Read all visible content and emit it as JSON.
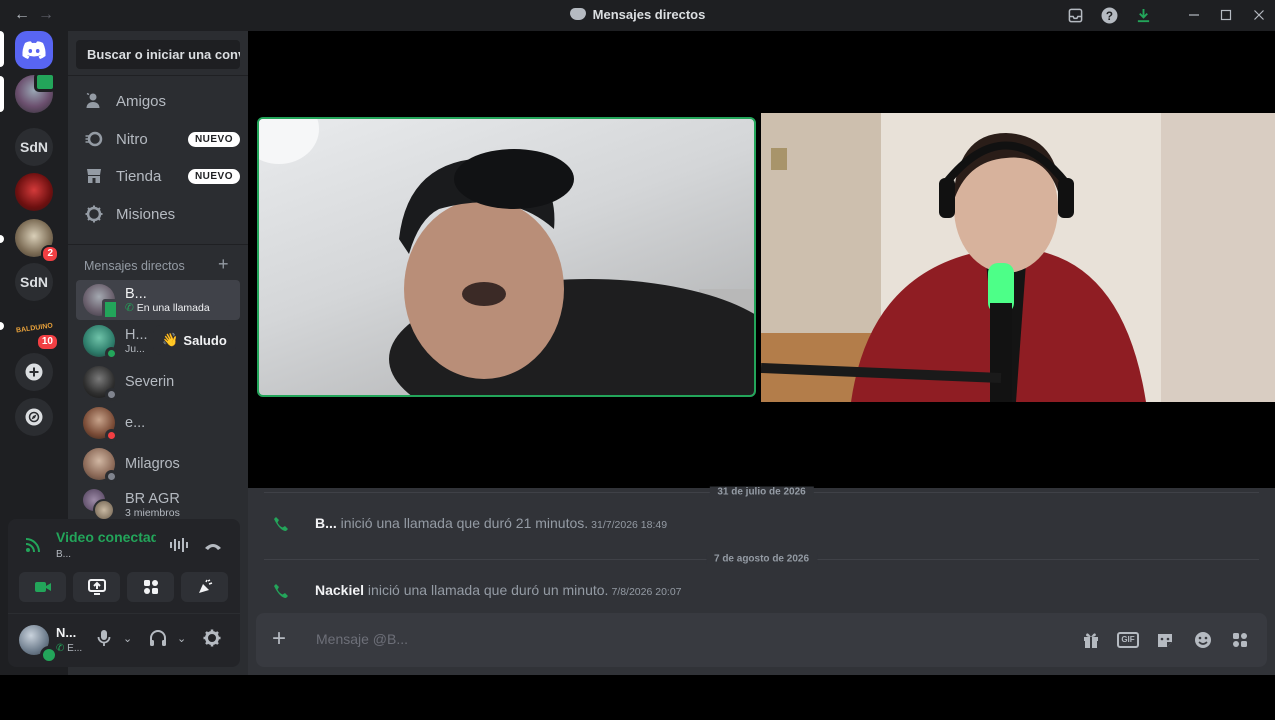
{
  "titlebar": {
    "back": "←",
    "forward": "→",
    "title": "Mensajes directos",
    "icons": [
      "inbox-icon",
      "help-icon",
      "download-icon",
      "minimize-icon",
      "maximize-icon",
      "close-icon"
    ]
  },
  "rail": {
    "servers": [
      {
        "type": "home",
        "icon": "discord-logo-icon"
      },
      {
        "type": "avatar",
        "status": "video-call"
      },
      {
        "type": "text",
        "label": "SdN"
      },
      {
        "type": "avatar"
      },
      {
        "type": "avatar",
        "badge": "2"
      },
      {
        "type": "text",
        "label": "SdN"
      },
      {
        "type": "avatar",
        "label": "BALDUINO",
        "badge": "10"
      },
      {
        "type": "add",
        "icon": "+"
      },
      {
        "type": "explore",
        "icon": "compass-icon"
      }
    ]
  },
  "sidebar": {
    "search": "Buscar o iniciar una conversación",
    "nav": [
      {
        "label": "Amigos",
        "icon": "friends-icon"
      },
      {
        "label": "Nitro",
        "icon": "nitro-icon",
        "badge": "NUEVO"
      },
      {
        "label": "Tienda",
        "icon": "shop-icon",
        "badge": "NUEVO"
      },
      {
        "label": "Misiones",
        "icon": "quests-icon"
      }
    ],
    "dm_header": "Mensajes directos",
    "dm_add": "+",
    "dms": [
      {
        "name": "B...",
        "sub": "En una llamada",
        "status": "mobile-green",
        "active": true
      },
      {
        "name": "H...",
        "sub": "Ju...",
        "status": "online"
      },
      {
        "name": "Severin",
        "sub": "",
        "status": "offline"
      },
      {
        "name": "e...",
        "sub": "",
        "status": "dnd"
      },
      {
        "name": "Milagros",
        "sub": "",
        "status": "offline"
      },
      {
        "name": "BR AGR",
        "sub": "3 miembros",
        "status": "group"
      }
    ],
    "wave_button": "Saludo",
    "colors": {
      "accent": "#5865f2",
      "green": "#23a55a",
      "red": "#f23f43"
    }
  },
  "voice": {
    "status": "Video conectado",
    "channel": "B...",
    "buttons": [
      "camera-icon",
      "screen-share-icon",
      "activities-icon",
      "soundboard-icon"
    ]
  },
  "user": {
    "name": "N...",
    "sub": "E..."
  },
  "chat": {
    "messages": [
      {
        "date": "31 de julio de 2026",
        "author": "B...",
        "text": " inició una llamada que duró 21 minutos.",
        "timestamp": "31/7/2026 18:49"
      },
      {
        "date": "7 de agosto de 2026",
        "author": "Nackiel",
        "text": " inició una llamada que duró un minuto.",
        "timestamp": "7/8/2026 20:07"
      }
    ],
    "composer_placeholder": "Mensaje @B...",
    "composer_plus": "+",
    "composer_icons": [
      "gift-icon",
      "gif-icon",
      "sticker-icon",
      "emoji-icon",
      "apps-icon"
    ],
    "gif_label": "GIF"
  }
}
